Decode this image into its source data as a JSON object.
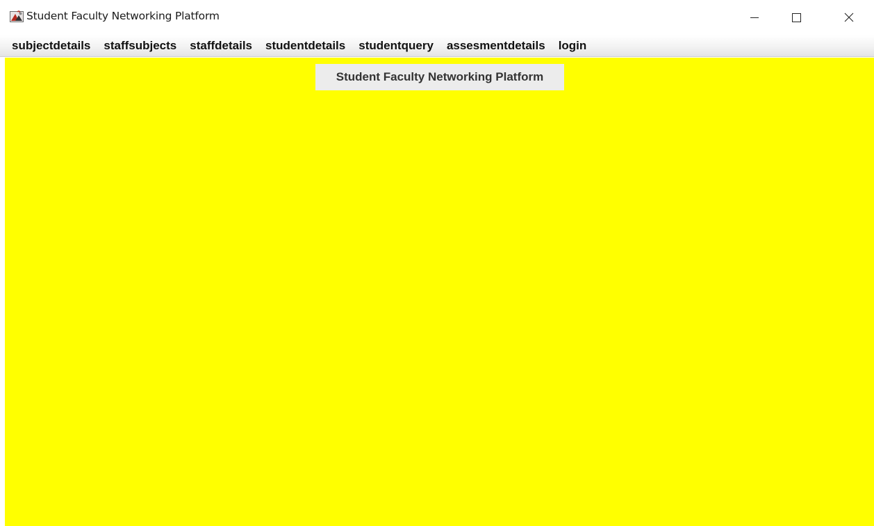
{
  "window": {
    "title": "Student Faculty Networking Platform"
  },
  "menubar": {
    "items": [
      {
        "label": "subjectdetails"
      },
      {
        "label": "staffsubjects"
      },
      {
        "label": "staffdetails"
      },
      {
        "label": "studentdetails"
      },
      {
        "label": "studentquery"
      },
      {
        "label": "assesmentdetails"
      },
      {
        "label": "login"
      }
    ]
  },
  "main": {
    "heading": "Student Faculty Networking Platform"
  },
  "colors": {
    "content_background": "#ffff00",
    "heading_background": "#ececec",
    "menubar_background": "#f1f1f1"
  },
  "icons": {
    "app": "java-cup-icon",
    "minimize": "minimize-icon",
    "maximize": "maximize-icon",
    "close": "close-icon"
  }
}
